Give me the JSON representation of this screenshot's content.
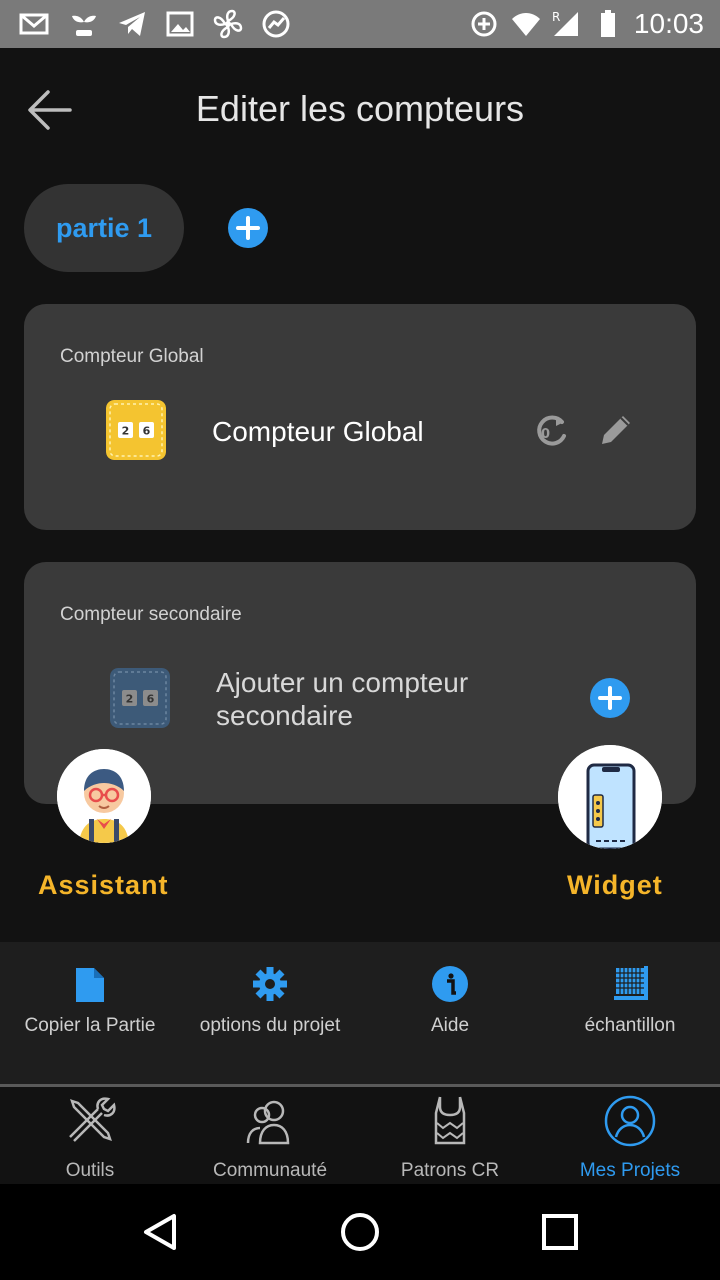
{
  "status_bar": {
    "time": "10:03",
    "left_icons": [
      "gmail-icon",
      "plant-icon",
      "telegram-icon",
      "image-icon",
      "fan-icon",
      "speedometer-icon"
    ],
    "right_icons": [
      "data-saver-icon",
      "wifi-icon",
      "signal-roaming-icon",
      "battery-icon"
    ]
  },
  "header": {
    "title": "Editer les compteurs"
  },
  "tabs": [
    {
      "label": "partie 1",
      "active": true
    }
  ],
  "global_card": {
    "section_label": "Compteur Global",
    "counter_name": "Compteur Global",
    "counter_digits": [
      "2",
      "6"
    ]
  },
  "secondary_card": {
    "section_label": "Compteur secondaire",
    "add_text": "Ajouter un compteur secondaire",
    "counter_digits": [
      "2",
      "6"
    ]
  },
  "floating": {
    "assistant_label": "Assistant",
    "widget_label": "Widget"
  },
  "actions": [
    {
      "label": "Copier la Partie",
      "icon": "copy-file-icon"
    },
    {
      "label": "options du projet",
      "icon": "gear-icon"
    },
    {
      "label": "Aide",
      "icon": "info-icon"
    },
    {
      "label": "échantillon",
      "icon": "swatch-icon"
    }
  ],
  "bottom_nav": [
    {
      "label": "Outils",
      "icon": "tools-icon",
      "active": false
    },
    {
      "label": "Communauté",
      "icon": "community-icon",
      "active": false
    },
    {
      "label": "Patrons CR",
      "icon": "sweater-icon",
      "active": false
    },
    {
      "label": "Mes Projets",
      "icon": "profile-icon",
      "active": true
    }
  ],
  "colors": {
    "accent": "#2f9bf0",
    "highlight": "#f5b52a",
    "card": "#3a3a3a",
    "background": "#121212"
  }
}
